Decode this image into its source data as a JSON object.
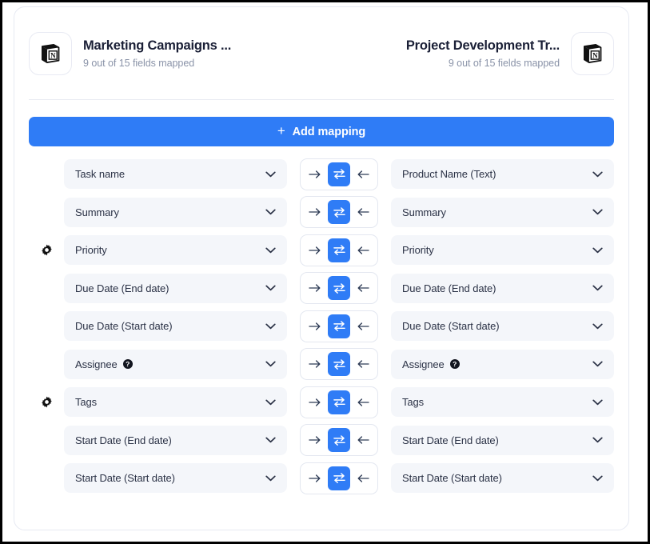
{
  "colors": {
    "accent": "#2f7cf6",
    "select_bg": "#f4f6fa",
    "text": "#2b3246",
    "muted": "#8a93a8",
    "frame": "#000000"
  },
  "header": {
    "left": {
      "icon": "notion-logo-icon",
      "title": "Marketing Campaigns ...",
      "subtitle": "9 out of 15 fields mapped"
    },
    "right": {
      "icon": "notion-logo-icon",
      "title": "Project Development Tr...",
      "subtitle": "9 out of 15 fields mapped"
    }
  },
  "toolbar": {
    "add_mapping_label": "Add mapping",
    "add_mapping_plus": "+"
  },
  "direction_toggle": {
    "left_to_right_icon": "arrow-right-icon",
    "bidirectional_icon": "bidirectional-sync-icon",
    "right_to_left_icon": "arrow-left-icon",
    "active": "bidirectional"
  },
  "icons": {
    "chevron_down": "chevron-down-icon",
    "gear": "gear-icon",
    "help": "help-icon",
    "help_glyph": "?"
  },
  "rows": [
    {
      "gear": false,
      "left": {
        "label": "Task name",
        "help": false
      },
      "direction": "bidirectional",
      "right": {
        "label": "Product Name (Text)",
        "help": false
      }
    },
    {
      "gear": false,
      "left": {
        "label": "Summary",
        "help": false
      },
      "direction": "bidirectional",
      "right": {
        "label": "Summary",
        "help": false
      }
    },
    {
      "gear": true,
      "left": {
        "label": "Priority",
        "help": false
      },
      "direction": "bidirectional",
      "right": {
        "label": "Priority",
        "help": false
      }
    },
    {
      "gear": false,
      "left": {
        "label": "Due Date (End date)",
        "help": false
      },
      "direction": "bidirectional",
      "right": {
        "label": "Due Date (End date)",
        "help": false
      }
    },
    {
      "gear": false,
      "left": {
        "label": "Due Date (Start date)",
        "help": false
      },
      "direction": "bidirectional",
      "right": {
        "label": "Due Date (Start date)",
        "help": false
      }
    },
    {
      "gear": false,
      "left": {
        "label": "Assignee",
        "help": true
      },
      "direction": "bidirectional",
      "right": {
        "label": "Assignee",
        "help": true
      }
    },
    {
      "gear": true,
      "left": {
        "label": "Tags",
        "help": false
      },
      "direction": "bidirectional",
      "right": {
        "label": "Tags",
        "help": false
      }
    },
    {
      "gear": false,
      "left": {
        "label": "Start Date (End date)",
        "help": false
      },
      "direction": "bidirectional",
      "right": {
        "label": "Start Date (End date)",
        "help": false
      }
    },
    {
      "gear": false,
      "left": {
        "label": "Start Date (Start date)",
        "help": false
      },
      "direction": "bidirectional",
      "right": {
        "label": "Start Date (Start date)",
        "help": false
      }
    }
  ]
}
